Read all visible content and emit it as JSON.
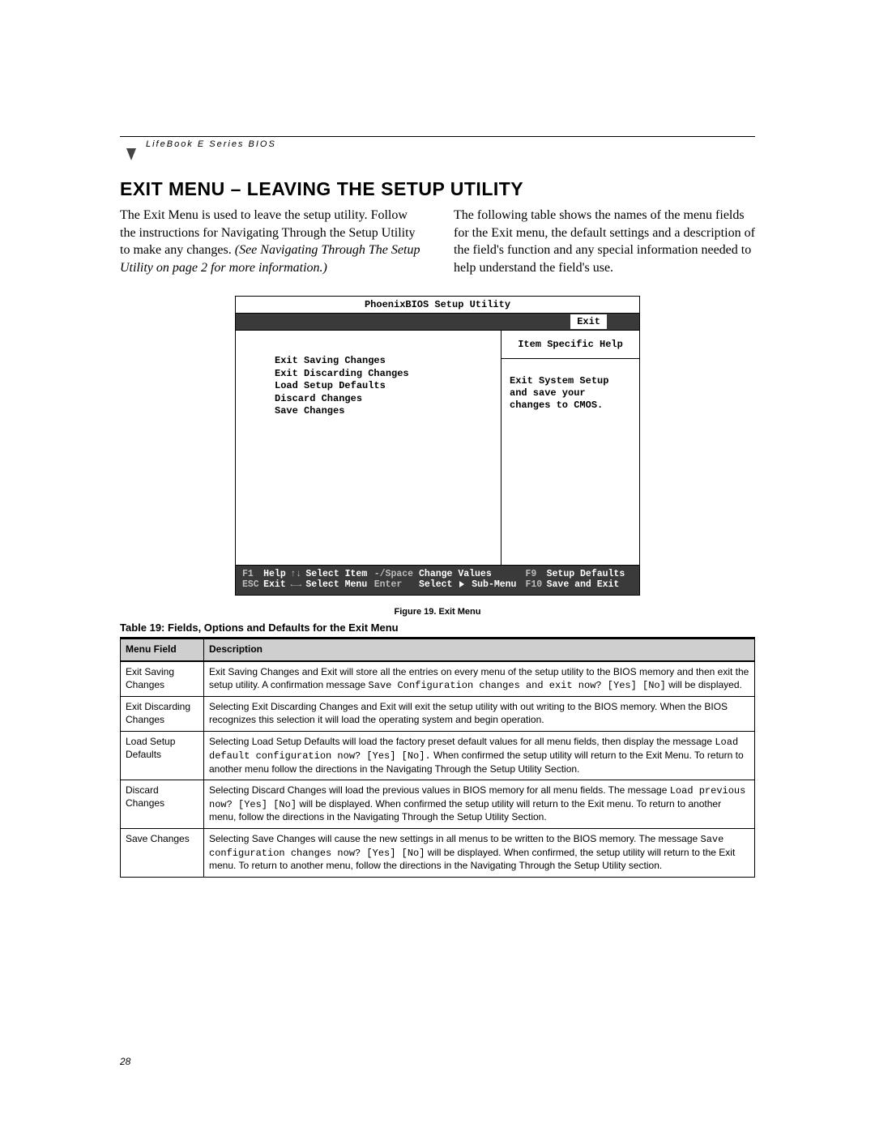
{
  "header": {
    "series": "LifeBook E Series BIOS"
  },
  "title": "EXIT MENU – LEAVING THE SETUP UTILITY",
  "intro": {
    "left_plain": "The Exit Menu is used to leave the setup utility. Follow the instructions for Navigating Through the Setup Utility to make any changes. ",
    "left_italic": "(See Navigating Through The Setup Utility on page 2 for more information.)",
    "right": "The following table shows the names of the menu fields for the Exit menu, the default settings and a description of the field's function and any special information needed to help understand the field's use."
  },
  "bios": {
    "title": "PhoenixBIOS Setup Utility",
    "tab_label": "Exit",
    "menu_items": [
      "Exit Saving Changes",
      "Exit Discarding Changes",
      "Load Setup Defaults",
      "Discard Changes",
      "Save Changes"
    ],
    "help_title": "Item Specific Help",
    "help_body": "Exit System Setup and save your changes to CMOS.",
    "footer": {
      "f1_key": "F1",
      "f1_label": "Help",
      "esc_key": "ESC",
      "esc_label": "Exit",
      "sel_item_key": "↑↓",
      "sel_item_label": "Select Item",
      "sel_menu_key": "←→",
      "sel_menu_label": "Select Menu",
      "chg_key": "-/Space",
      "chg_label": "Change Values",
      "enter_key": "Enter",
      "enter_label_pre": "Select",
      "enter_label_post": "Sub-Menu",
      "f9_key": "F9",
      "f9_label": "Setup Defaults",
      "f10_key": "F10",
      "f10_label": "Save and Exit"
    }
  },
  "figure_caption": "Figure 19.  Exit Menu",
  "table_title": "Table 19: Fields, Options and Defaults for the Exit Menu",
  "table_headers": {
    "field": "Menu Field",
    "desc": "Description"
  },
  "table_rows": [
    {
      "field": "Exit Saving Changes",
      "desc_pre": "Exit Saving Changes and Exit will store all the entries on every menu of the setup utility to the BIOS memory and then exit the setup utility. A confirmation message ",
      "desc_code": "Save Configuration changes and exit now? [Yes] [No]",
      "desc_post": " will be displayed."
    },
    {
      "field": "Exit Discarding Changes",
      "desc_pre": "Selecting Exit Discarding Changes and Exit will exit the setup utility with out writing to the BIOS memory. When the BIOS recognizes this selection it will load the operating system and begin operation.",
      "desc_code": "",
      "desc_post": ""
    },
    {
      "field": "Load Setup Defaults",
      "desc_pre": "Selecting Load Setup Defaults will load the factory preset default values for all menu fields, then display the message ",
      "desc_code": "Load default configuration now? [Yes] [No].",
      "desc_post": " When confirmed the setup utility will return to the Exit Menu. To return to another menu follow the directions in the Navigating Through the Setup Utility Section."
    },
    {
      "field": "Discard Changes",
      "desc_pre": "Selecting Discard Changes will load the previous values in BIOS memory for all menu fields. The message ",
      "desc_code": "Load previous now? [Yes] [No]",
      "desc_post": " will be displayed. When confirmed the setup utility will return to the Exit menu. To return to another menu, follow the directions in the Navigating Through the Setup Utility Section."
    },
    {
      "field": "Save Changes",
      "desc_pre": "Selecting Save Changes will cause the new settings in all menus to be written to the BIOS memory. The message ",
      "desc_code": "Save configuration changes now? [Yes] [No]",
      "desc_post": " will be displayed. When confirmed, the setup utility will return to the Exit menu. To return to another menu, follow the directions in the Navigating Through the Setup Utility section."
    }
  ],
  "page_number": "28"
}
